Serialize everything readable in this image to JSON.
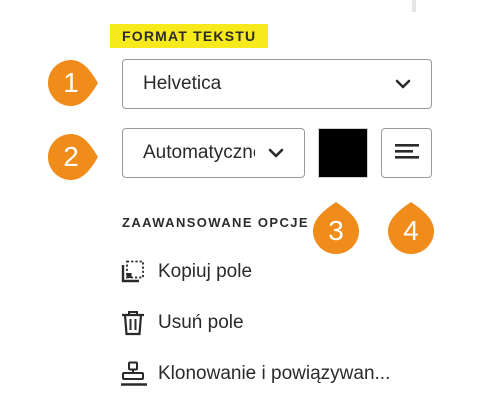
{
  "panel": {
    "section_title": "FORMAT TEKSTU",
    "font_select": {
      "value": "Helvetica"
    },
    "size_select": {
      "value": "Automatyczne"
    },
    "color": {
      "value": "#000000"
    },
    "alignment": {
      "icon": "align-left-icon"
    },
    "advanced": {
      "title": "ZAAWANSOWANE OPCJE",
      "items": [
        {
          "label": "Kopiuj pole",
          "icon": "copy-field-icon"
        },
        {
          "label": "Usuń pole",
          "icon": "trash-icon"
        },
        {
          "label": "Klonowanie i powiązywan...",
          "icon": "stamp-icon"
        }
      ]
    }
  },
  "callouts": [
    "1",
    "2",
    "3",
    "4"
  ],
  "colors": {
    "accent_yellow": "#f7ea1c",
    "callout_orange": "#f08c1a",
    "text": "#2a2a2a",
    "border": "#9a9a9a"
  }
}
